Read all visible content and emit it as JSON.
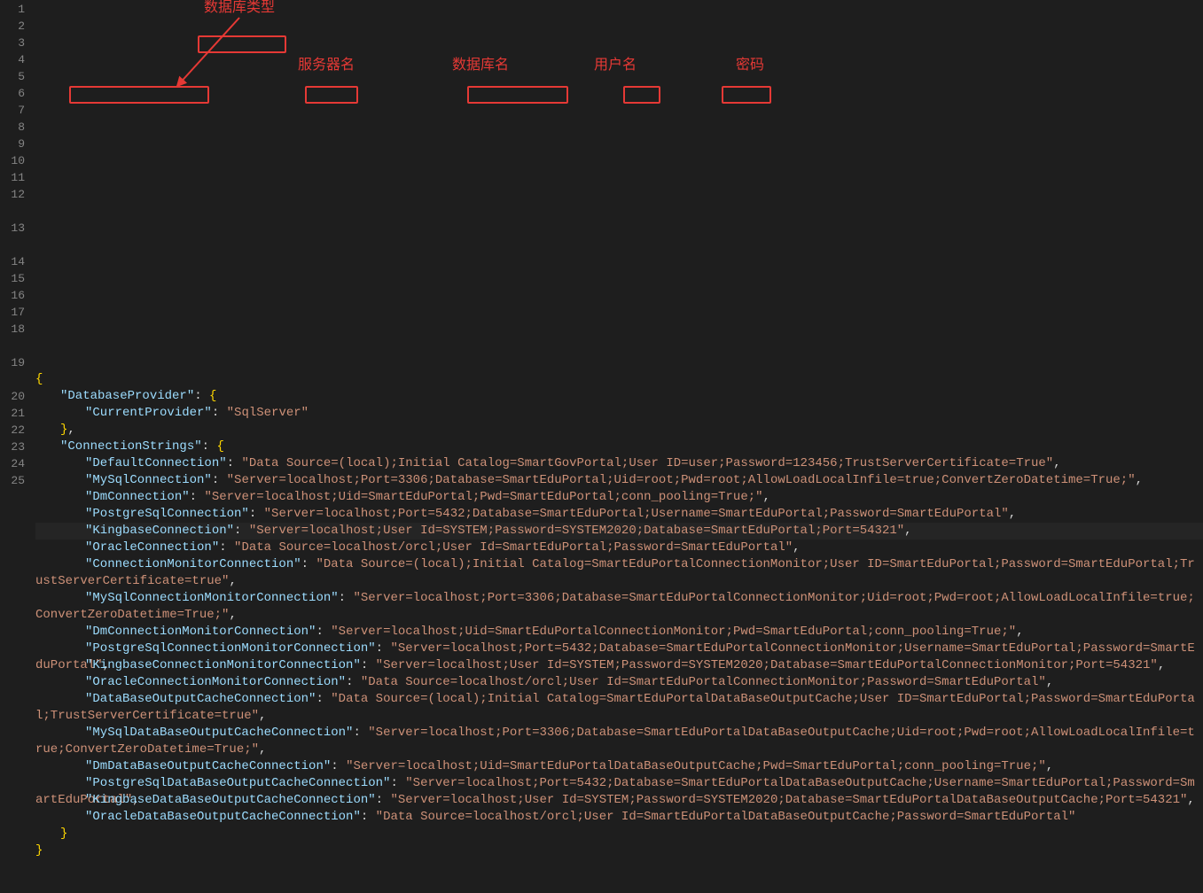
{
  "lineNumbers": [
    "1",
    "2",
    "3",
    "4",
    "5",
    "6",
    "7",
    "8",
    "9",
    "10",
    "11",
    "12",
    "13",
    "14",
    "15",
    "16",
    "17",
    "18",
    "19",
    "20",
    "21",
    "22",
    "23",
    "24",
    "25"
  ],
  "annotations": {
    "dbType": "数据库类型",
    "serverName": "服务器名",
    "dbName": "数据库名",
    "userName": "用户名",
    "password": "密码"
  },
  "json": {
    "DatabaseProvider": {
      "CurrentProvider": "SqlServer"
    },
    "ConnectionStrings": {
      "DefaultConnection": "Data Source=(local);Initial Catalog=SmartGovPortal;User ID=user;Password=123456;TrustServerCertificate=True",
      "MySqlConnection": "Server=localhost;Port=3306;Database=SmartEduPortal;Uid=root;Pwd=root;AllowLoadLocalInfile=true;ConvertZeroDatetime=True;",
      "DmConnection": "Server=localhost;Uid=SmartEduPortal;Pwd=SmartEduPortal;conn_pooling=True;",
      "PostgreSqlConnection": "Server=localhost;Port=5432;Database=SmartEduPortal;Username=SmartEduPortal;Password=SmartEduPortal",
      "KingbaseConnection": "Server=localhost;User Id=SYSTEM;Password=SYSTEM2020;Database=SmartEduPortal;Port=54321",
      "OracleConnection": "Data Source=localhost/orcl;User Id=SmartEduPortal;Password=SmartEduPortal",
      "ConnectionMonitorConnection": "Data Source=(local);Initial Catalog=SmartEduPortalConnectionMonitor;User ID=SmartEduPortal;Password=SmartEduPortal;TrustServerCertificate=true",
      "MySqlConnectionMonitorConnection": "Server=localhost;Port=3306;Database=SmartEduPortalConnectionMonitor;Uid=root;Pwd=root;AllowLoadLocalInfile=true;ConvertZeroDatetime=True;",
      "DmConnectionMonitorConnection": "Server=localhost;Uid=SmartEduPortalConnectionMonitor;Pwd=SmartEduPortal;conn_pooling=True;",
      "PostgreSqlConnectionMonitorConnection": "Server=localhost;Port=5432;Database=SmartEduPortalConnectionMonitor;Username=SmartEduPortal;Password=SmartEduPortal",
      "KingbaseConnectionMonitorConnection": "Server=localhost;User Id=SYSTEM;Password=SYSTEM2020;Database=SmartEduPortalConnectionMonitor;Port=54321",
      "OracleConnectionMonitorConnection": "Data Source=localhost/orcl;User Id=SmartEduPortalConnectionMonitor;Password=SmartEduPortal",
      "DataBaseOutputCacheConnection": "Data Source=(local);Initial Catalog=SmartEduPortalDataBaseOutputCache;User ID=SmartEduPortal;Password=SmartEduPortal;TrustServerCertificate=true",
      "MySqlDataBaseOutputCacheConnection": "Server=localhost;Port=3306;Database=SmartEduPortalDataBaseOutputCache;Uid=root;Pwd=root;AllowLoadLocalInfile=true;ConvertZeroDatetime=True;",
      "DmDataBaseOutputCacheConnection": "Server=localhost;Uid=SmartEduPortalDataBaseOutputCache;Pwd=SmartEduPortal;conn_pooling=True;",
      "PostgreSqlDataBaseOutputCacheConnection": "Server=localhost;Port=5432;Database=SmartEduPortalDataBaseOutputCache;Username=SmartEduPortal;Password=SmartEduPortal",
      "KingbaseDataBaseOutputCacheConnection": "Server=localhost;User Id=SYSTEM;Password=SYSTEM2020;Database=SmartEduPortalDataBaseOutputCache;Port=54321",
      "OracleDataBaseOutputCacheConnection": "Data Source=localhost/orcl;User Id=SmartEduPortalDataBaseOutputCache;Password=SmartEduPortal"
    }
  }
}
